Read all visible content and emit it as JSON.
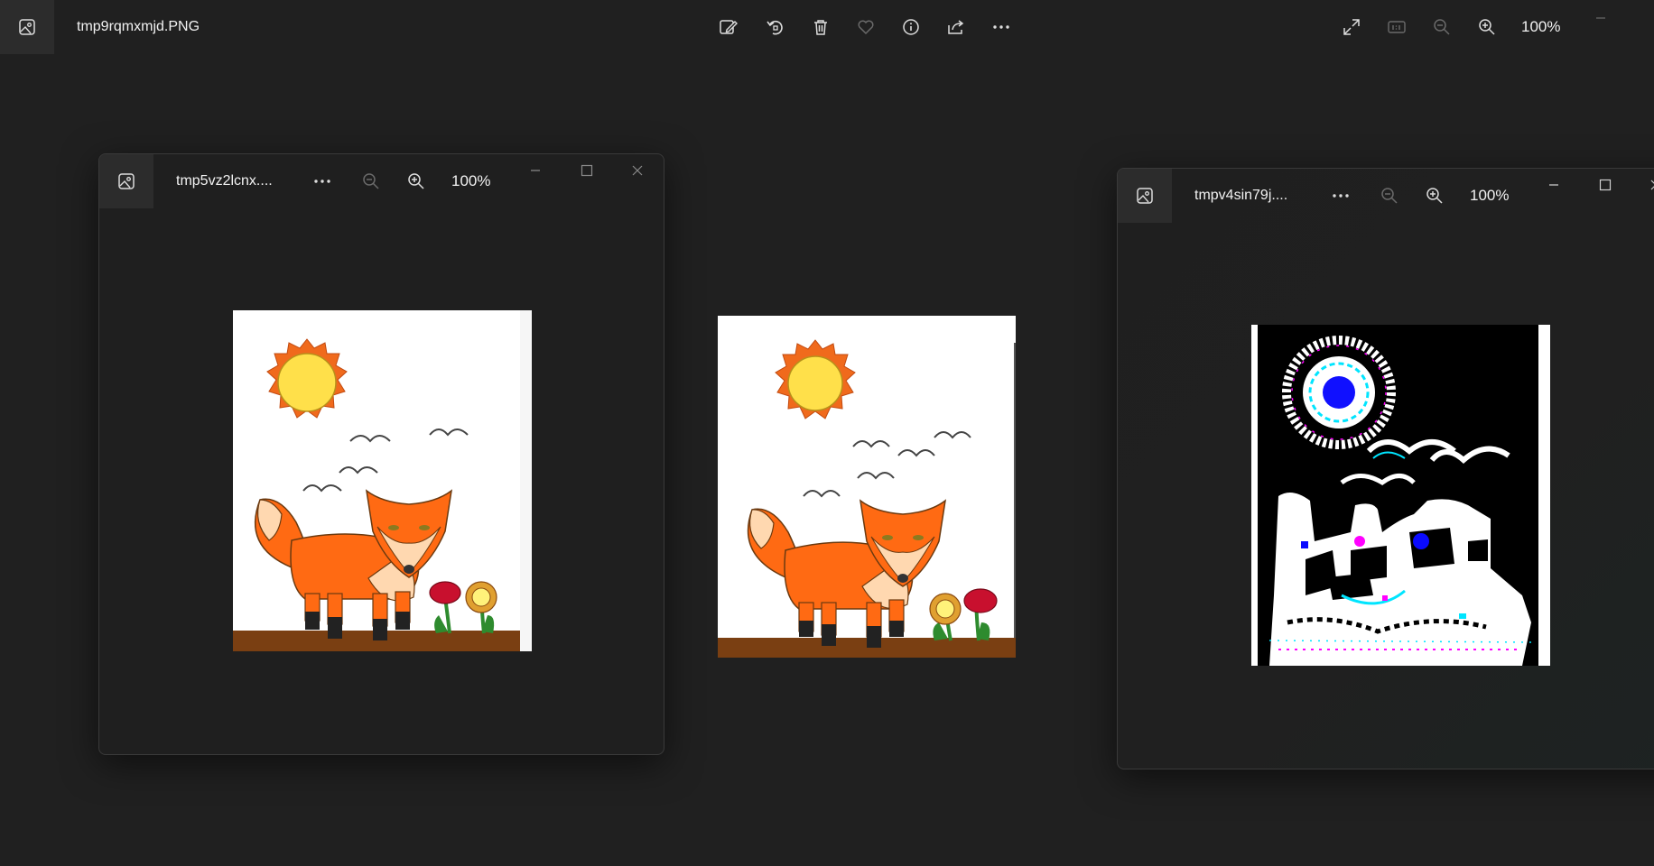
{
  "main_window": {
    "title": "tmp9rqmxmjd.PNG",
    "toolbar": {
      "icons": [
        "edit-image-icon",
        "rotate-icon",
        "delete-icon",
        "favorite-heart-icon",
        "info-icon",
        "share-icon",
        "more-options-icon"
      ]
    },
    "right_controls": {
      "icons": [
        "fullscreen-icon",
        "actual-size-icon",
        "zoom-out-icon",
        "zoom-in-icon"
      ],
      "zoom_level": "100%"
    },
    "window_controls": [
      "minimize-icon"
    ]
  },
  "sub_windows": [
    {
      "title": "tmp5vz2lcnx....",
      "zoom_level": "100%"
    },
    {
      "title": "tmpv4sin79j....",
      "zoom_level": "100%"
    }
  ],
  "colors": {
    "background": "#202020",
    "sun": "#ffe04a",
    "sun_rays": "#f06a1c",
    "fox": "#ff6a13",
    "fox_light": "#ffd8b0",
    "ground": "#7a3f12",
    "flower_red": "#c8102e",
    "leaf": "#2e8b2e"
  }
}
